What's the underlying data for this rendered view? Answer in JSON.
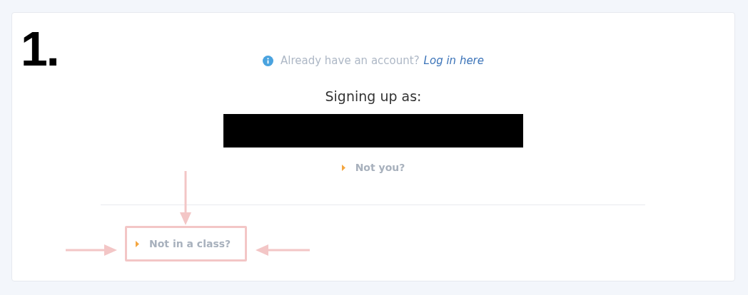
{
  "annotation": {
    "step_number": "1."
  },
  "login_prompt": {
    "text": "Already have an account?",
    "link": "Log in here"
  },
  "signup": {
    "heading": "Signing up as:",
    "redacted": true
  },
  "not_you": {
    "label": "Not you?"
  },
  "not_in_class": {
    "label": "Not in a class?",
    "highlighted": true
  }
}
